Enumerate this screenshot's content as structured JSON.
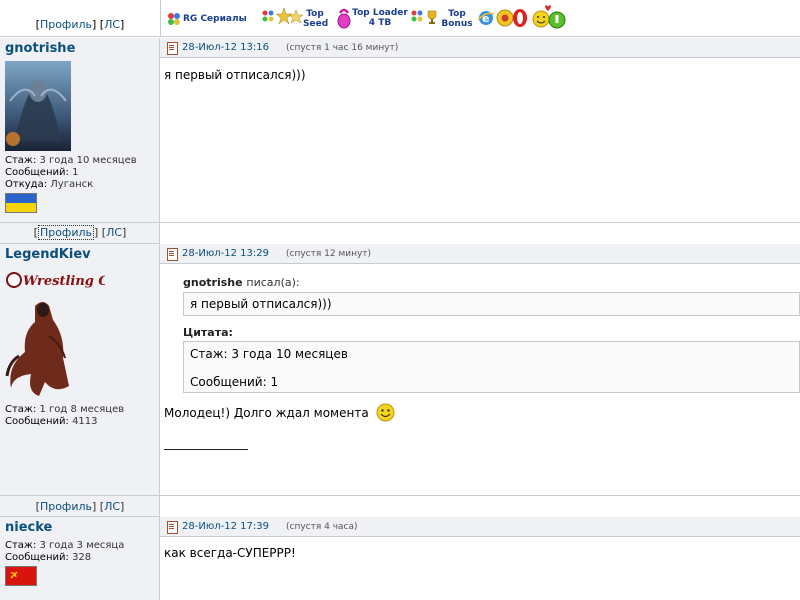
{
  "topbar": {
    "items": [
      {
        "icon": "rg-icon",
        "label": "RG Сериалы"
      },
      {
        "icon": "stars-icon",
        "label1": "Top",
        "label2": "Seed"
      },
      {
        "icon": "kettlebell-icon",
        "label1": "Top Loader",
        "label2": "4 TB"
      },
      {
        "icon": "trophy-icon",
        "label1": "Top",
        "label2": "Bonus"
      }
    ]
  },
  "profile_links": {
    "profile": "Профиль",
    "pm": "ЛС"
  },
  "posts": [
    {
      "author": "gnotrishe",
      "stats": [
        {
          "k": "Стаж:",
          "v": "3 года 10 месяцев"
        },
        {
          "k": "Сообщений:",
          "v": "1"
        },
        {
          "k": "Откуда:",
          "v": "Луганск"
        }
      ],
      "flag": "ukraine",
      "date": "28-Июл-12 13:16",
      "ago": "(спустя 1 час 16 минут)",
      "text": "я первый отписался)))"
    },
    {
      "author": "LegendKiev",
      "banner": "Wrestling Group",
      "stats": [
        {
          "k": "Стаж:",
          "v": "1 год 8 месяцев"
        },
        {
          "k": "Сообщений:",
          "v": "4113"
        }
      ],
      "date": "28-Июл-12 13:29",
      "ago": "(спустя 12 минут)",
      "quote_author": "gnotrishe",
      "quote_wrote": "писал(а):",
      "quote_text": "я первый отписался)))",
      "cite_label": "Цитата:",
      "cite_line1": "Стаж: 3 года 10 месяцев",
      "cite_line2": "Сообщений: 1",
      "text": "Молодец!) Долго ждал момента",
      "signature": "______________"
    },
    {
      "author": "niecke",
      "stats": [
        {
          "k": "Стаж:",
          "v": "3 года 3 месяца"
        },
        {
          "k": "Сообщений:",
          "v": "328"
        }
      ],
      "flag": "ussr",
      "date": "28-Июл-12 17:39",
      "ago": "(спустя 4 часа)",
      "text": "как всегда-СУПЕРРР!"
    }
  ]
}
